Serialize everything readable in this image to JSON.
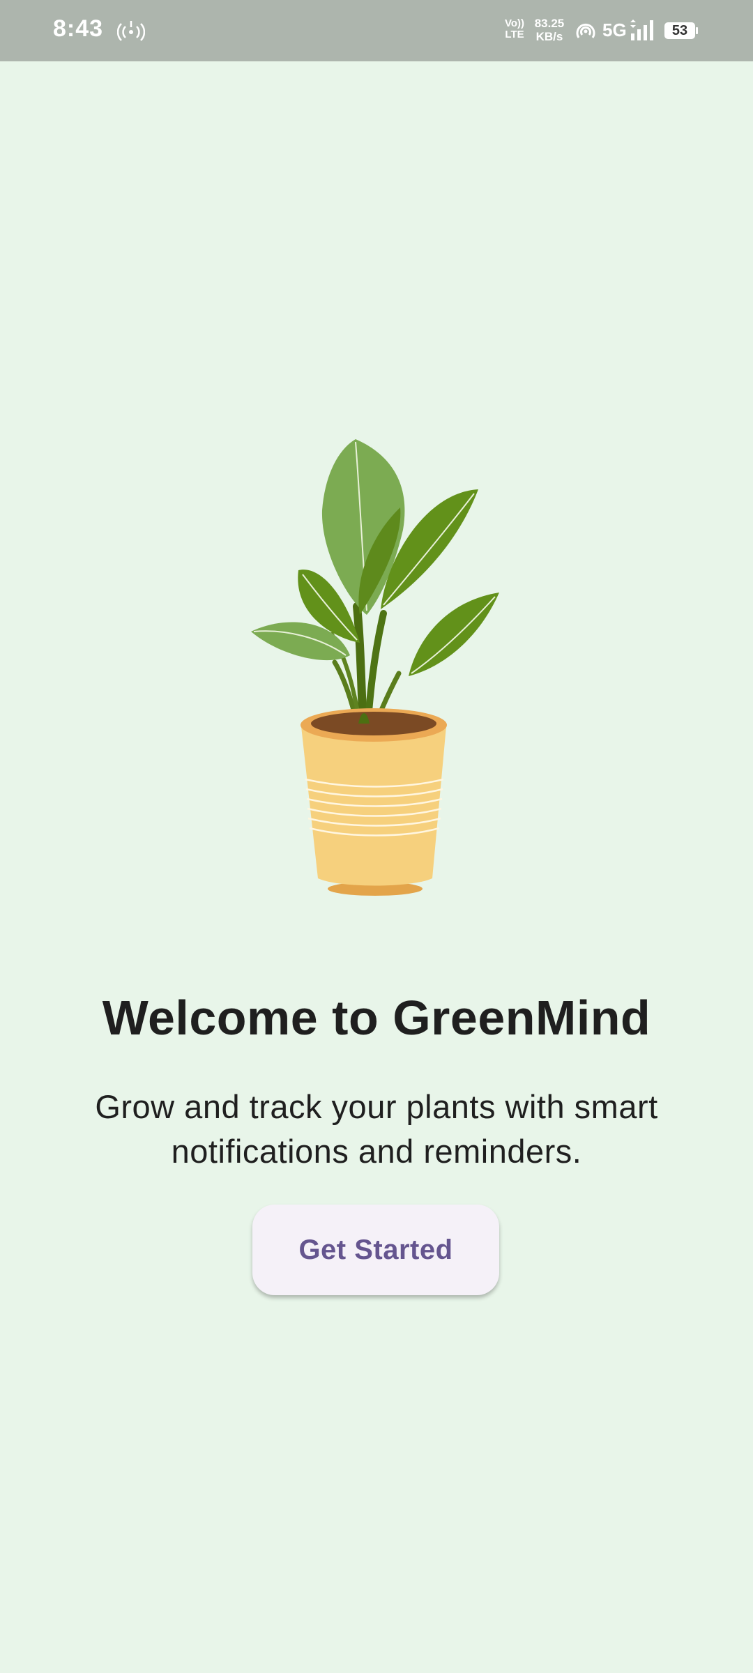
{
  "status_bar": {
    "time": "8:43",
    "volte_line1": "Vo))",
    "volte_line2": "LTE",
    "speed_value": "83.25",
    "speed_unit": "KB/s",
    "network_type": "5G",
    "battery_level": "53"
  },
  "onboarding": {
    "title": "Welcome to GreenMind",
    "subtitle": "Grow and track your plants with smart notifications and reminders.",
    "cta_label": "Get Started"
  },
  "icons": {
    "hotspot": "hotspot-icon",
    "hotspot_wave": "hotspot-wave-icon",
    "signal": "signal-strength-icon",
    "battery": "battery-icon",
    "plant": "potted-plant-illustration"
  },
  "colors": {
    "background": "#e8f5e9",
    "status_bar": "#adb5ad",
    "title_text": "#1f1f1f",
    "button_background": "#f5f1f8",
    "button_text": "#65558f",
    "leaf_light": "#7cab52",
    "leaf_dark": "#62911a",
    "pot": "#f6d07d",
    "soil": "#7b4a24"
  }
}
